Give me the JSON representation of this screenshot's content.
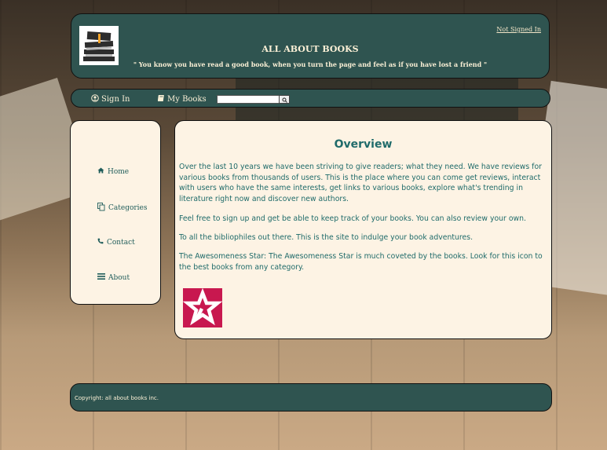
{
  "header": {
    "signin_status": "Not Signed In",
    "title": "ALL ABOUT BOOKS",
    "tagline": "\" You know you have read a good book, when you turn the page and feel as if you have lost a friend \""
  },
  "navbar": {
    "signin": {
      "label": "Sign In",
      "icon": "user-circle-icon"
    },
    "mybooks": {
      "label": "My Books",
      "icon": "book-icon"
    },
    "search": {
      "value": "",
      "button_icon": "search-icon"
    }
  },
  "sidebar": {
    "items": [
      {
        "label": "Home",
        "icon": "home-icon"
      },
      {
        "label": "Categories",
        "icon": "copy-icon"
      },
      {
        "label": "Contact",
        "icon": "phone-icon"
      },
      {
        "label": "About",
        "icon": "list-icon"
      }
    ]
  },
  "main": {
    "heading": "Overview",
    "paragraphs": [
      "Over the last 10 years we have been striving to give readers; what they need. We have reviews for various books from thousands of users. This is the place where you can come get reviews, interact with users who have the same interests, get links to various books, explore what's trending in literature right now and discover new authors.",
      "Feel free to sign up and get be able to keep track of your books. You can also review your own.",
      "To all the bibliophiles out there. This is the site to indulge your book adventures.",
      "The Awesomeness Star: The Awesomeness Star is much coveted by the books. Look for this icon to the best books from any category."
    ]
  },
  "footer": {
    "copyright": "Copyright: all about books inc."
  },
  "colors": {
    "panel_dark": "#2f5450",
    "panel_light": "#fdf3e4",
    "text_teal": "#1f6b6a",
    "star_bg": "#c8184f"
  }
}
